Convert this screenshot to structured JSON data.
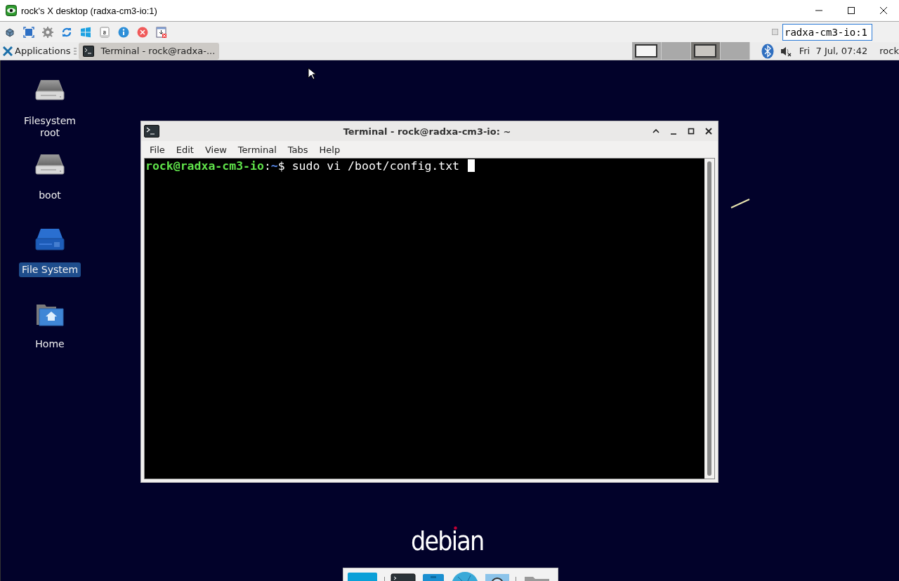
{
  "window": {
    "title": "rock's X desktop (radxa-cm3-io:1)"
  },
  "toolbar": {
    "host_field": {
      "value": "radxa-cm3-io:1"
    }
  },
  "panel": {
    "applications": "Applications",
    "tasks": [
      {
        "label": "Terminal - rock@radxa-...",
        "selected": true
      }
    ],
    "workspaces": [
      {
        "selected": false,
        "has_window": true
      },
      {
        "selected": false,
        "has_window": false
      },
      {
        "selected": true,
        "has_window": true
      },
      {
        "selected": false,
        "has_window": false
      }
    ],
    "clock": "Fri  7 Jul, 07:42",
    "user": "rock"
  },
  "desktop_icons": [
    {
      "label": "Filesystem root",
      "kind": "drive",
      "selected": false
    },
    {
      "label": "boot",
      "kind": "drive",
      "selected": false
    },
    {
      "label": "File System",
      "kind": "drive-blue",
      "selected": true
    },
    {
      "label": "Home",
      "kind": "home",
      "selected": false
    }
  ],
  "terminal": {
    "title": "Terminal - rock@radxa-cm3-io: ~",
    "menu": [
      "File",
      "Edit",
      "View",
      "Terminal",
      "Tabs",
      "Help"
    ],
    "prompt": {
      "user_host": "rock@radxa-cm3-io",
      "separator": ":",
      "path": "~",
      "symbol": "$",
      "command": "sudo vi /boot/config.txt"
    }
  },
  "logo": "debian"
}
